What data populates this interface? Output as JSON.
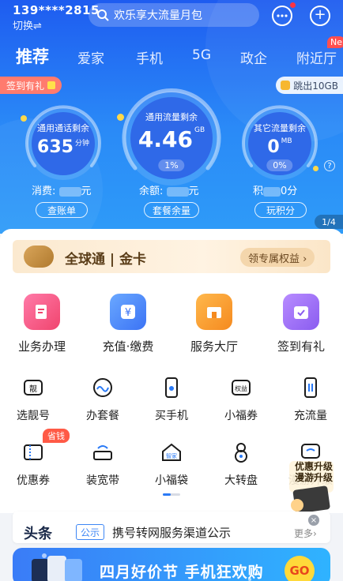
{
  "header": {
    "phone": "139****2815",
    "switch_label": "切换⇌",
    "search_placeholder": "欢乐享大流量月包"
  },
  "tabs": [
    "推荐",
    "爱家",
    "手机",
    "5G",
    "政企",
    "附近厅"
  ],
  "new_badge": "Ne",
  "signin_label": "签到有礼",
  "jump_label": "跳出10GB",
  "gauges": {
    "call": {
      "title": "通用通话剩余",
      "value": "635",
      "unit": "分钟"
    },
    "data": {
      "title": "通用流量剩余",
      "value": "4.46",
      "unit": "GB",
      "percent": "1%"
    },
    "other": {
      "title": "其它流量剩余",
      "value": "0",
      "unit": "MB",
      "percent": "0%"
    }
  },
  "stats": {
    "spend": "消费: ",
    "spend_tail": "元",
    "balance": "余额: ",
    "balance_tail": "元",
    "points": "积",
    "points_tail": "0分"
  },
  "pills": [
    "查账单",
    "套餐余量",
    "玩积分"
  ],
  "page_indicator": "1/4",
  "gold_card": {
    "title": "全球通 | 金卡",
    "button": "领专属权益 ›"
  },
  "main_services": [
    "业务办理",
    "充值·缴费",
    "服务大厅",
    "签到有礼"
  ],
  "row2": [
    "选靓号",
    "办套餐",
    "买手机",
    "小福券",
    "充流量"
  ],
  "row3": [
    "优惠券",
    "装宽带",
    "小福袋",
    "大转盘",
    "漫游升级"
  ],
  "save_badge": "省钱",
  "float_promo": "优惠升级 漫游升级",
  "news": {
    "head": "头条",
    "tag": "公示",
    "text": "携号转网服务渠道公示",
    "more": "更多›"
  },
  "banner": {
    "text": "四月好价节 手机狂欢购",
    "go": "GO"
  },
  "colors": {
    "primary": "#2a7af6",
    "gold": "#b07a2e",
    "red": "#ff5a46"
  }
}
